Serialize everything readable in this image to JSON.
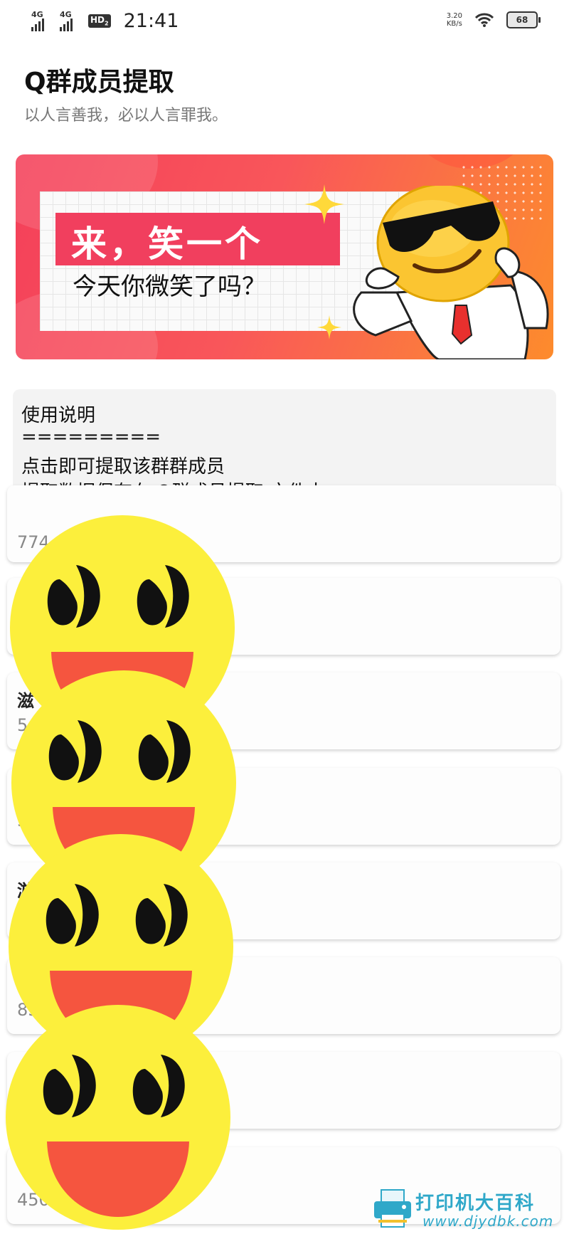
{
  "status_bar": {
    "network_1": "4G",
    "network_2": "4G",
    "hd_label": "HD",
    "hd_sub": "2",
    "time": "21:41",
    "speed_value": "3.20",
    "speed_unit": "KB/s",
    "battery": "68"
  },
  "header": {
    "title": "Q群成员提取",
    "subtitle": "以人言善我，必以人言罪我。"
  },
  "banner": {
    "headline": "来，笑一个",
    "subline": "今天你微笑了吗？"
  },
  "instructions": {
    "heading": "使用说明",
    "divider": "=========",
    "line1": "点击即可提取该群群成员",
    "line2": "提取数据保存在 Q群成员提取 文件夹"
  },
  "groups": [
    {
      "name": "",
      "number": "774"
    },
    {
      "name": "",
      "number": ""
    },
    {
      "name": "滋",
      "number": "5"
    },
    {
      "name": "",
      "number": "3"
    },
    {
      "name": "游",
      "number": ""
    },
    {
      "name": "",
      "number": "85"
    },
    {
      "name": "",
      "number": ""
    },
    {
      "name": "",
      "number": "450"
    }
  ],
  "watermark": {
    "text": "打印机大百科",
    "url": "www.djydbk.com"
  },
  "colors": {
    "banner_red": "#f13f5e",
    "banner_orange": "#fd8b2c",
    "smiley_yellow": "#fcef3c",
    "smiley_mouth": "#f5553f",
    "watermark_blue": "#2fa8c9"
  },
  "icons": [
    "signal-icon",
    "wifi-icon",
    "battery-icon",
    "sparkle-icon",
    "cool-emoji-icon",
    "smiley-face-icon",
    "printer-icon"
  ]
}
